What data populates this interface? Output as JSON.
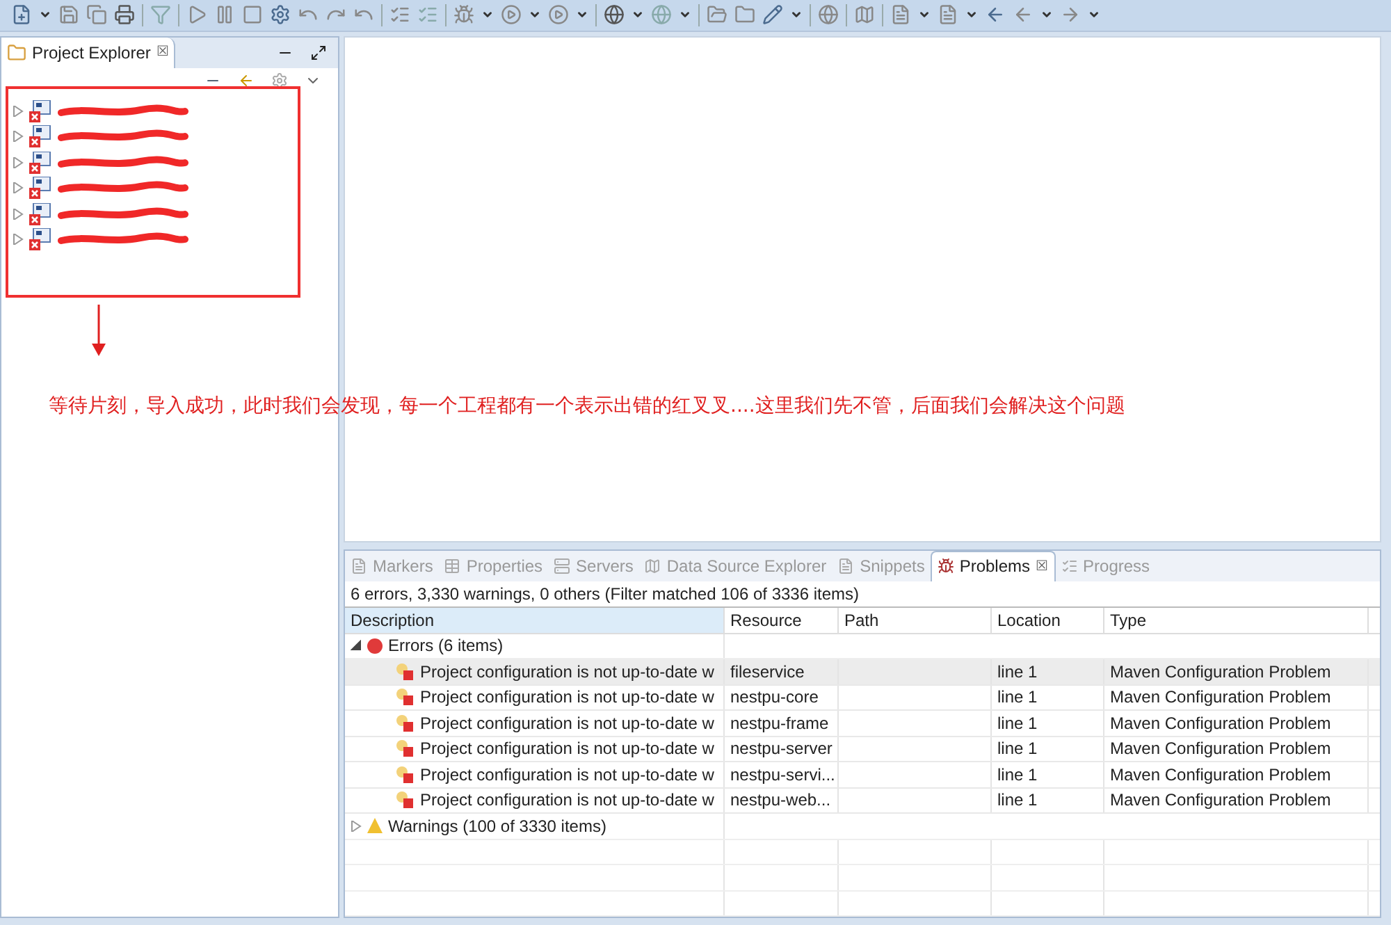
{
  "project_explorer": {
    "title": "Project Explorer",
    "close": "☒",
    "projects": [
      {
        "expanded": false,
        "has_error": true
      },
      {
        "expanded": false,
        "has_error": true
      },
      {
        "expanded": false,
        "has_error": true
      },
      {
        "expanded": false,
        "has_error": true
      },
      {
        "expanded": false,
        "has_error": true
      },
      {
        "expanded": false,
        "has_error": true
      }
    ]
  },
  "annotation": {
    "text": "等待片刻，导入成功，此时我们会发现，每一个工程都有一个表示出错的红叉叉....这里我们先不管，后面我们会解决这个问题"
  },
  "bottom_panel": {
    "tabs": [
      {
        "label": "Markers",
        "selected": false
      },
      {
        "label": "Properties",
        "selected": false
      },
      {
        "label": "Servers",
        "selected": false
      },
      {
        "label": "Data Source Explorer",
        "selected": false
      },
      {
        "label": "Snippets",
        "selected": false
      },
      {
        "label": "Problems",
        "selected": true,
        "close": "☒"
      },
      {
        "label": "Progress",
        "selected": false
      }
    ],
    "summary": "6 errors, 3,330 warnings, 0 others (Filter matched 106 of 3336 items)",
    "table": {
      "columns": [
        "Description",
        "Resource",
        "Path",
        "Location",
        "Type"
      ],
      "groups": [
        {
          "kind": "error",
          "label": "Errors (6 items)",
          "expanded": true,
          "rows": [
            {
              "description": "Project configuration is not up-to-date w",
              "resource": "fileservice",
              "location": "line 1",
              "type": "Maven Configuration Problem",
              "selected": true
            },
            {
              "description": "Project configuration is not up-to-date w",
              "resource": "nestpu-core",
              "location": "line 1",
              "type": "Maven Configuration Problem",
              "selected": false
            },
            {
              "description": "Project configuration is not up-to-date w",
              "resource": "nestpu-frame",
              "location": "line 1",
              "type": "Maven Configuration Problem",
              "selected": false
            },
            {
              "description": "Project configuration is not up-to-date w",
              "resource": "nestpu-server",
              "location": "line 1",
              "type": "Maven Configuration Problem",
              "selected": false
            },
            {
              "description": "Project configuration is not up-to-date w",
              "resource": "nestpu-servi...",
              "location": "line 1",
              "type": "Maven Configuration Problem",
              "selected": false
            },
            {
              "description": "Project configuration is not up-to-date w",
              "resource": "nestpu-web...",
              "location": "line 1",
              "type": "Maven Configuration Problem",
              "selected": false
            }
          ]
        },
        {
          "kind": "warning",
          "label": "Warnings (100 of 3330 items)",
          "expanded": false
        }
      ]
    }
  }
}
